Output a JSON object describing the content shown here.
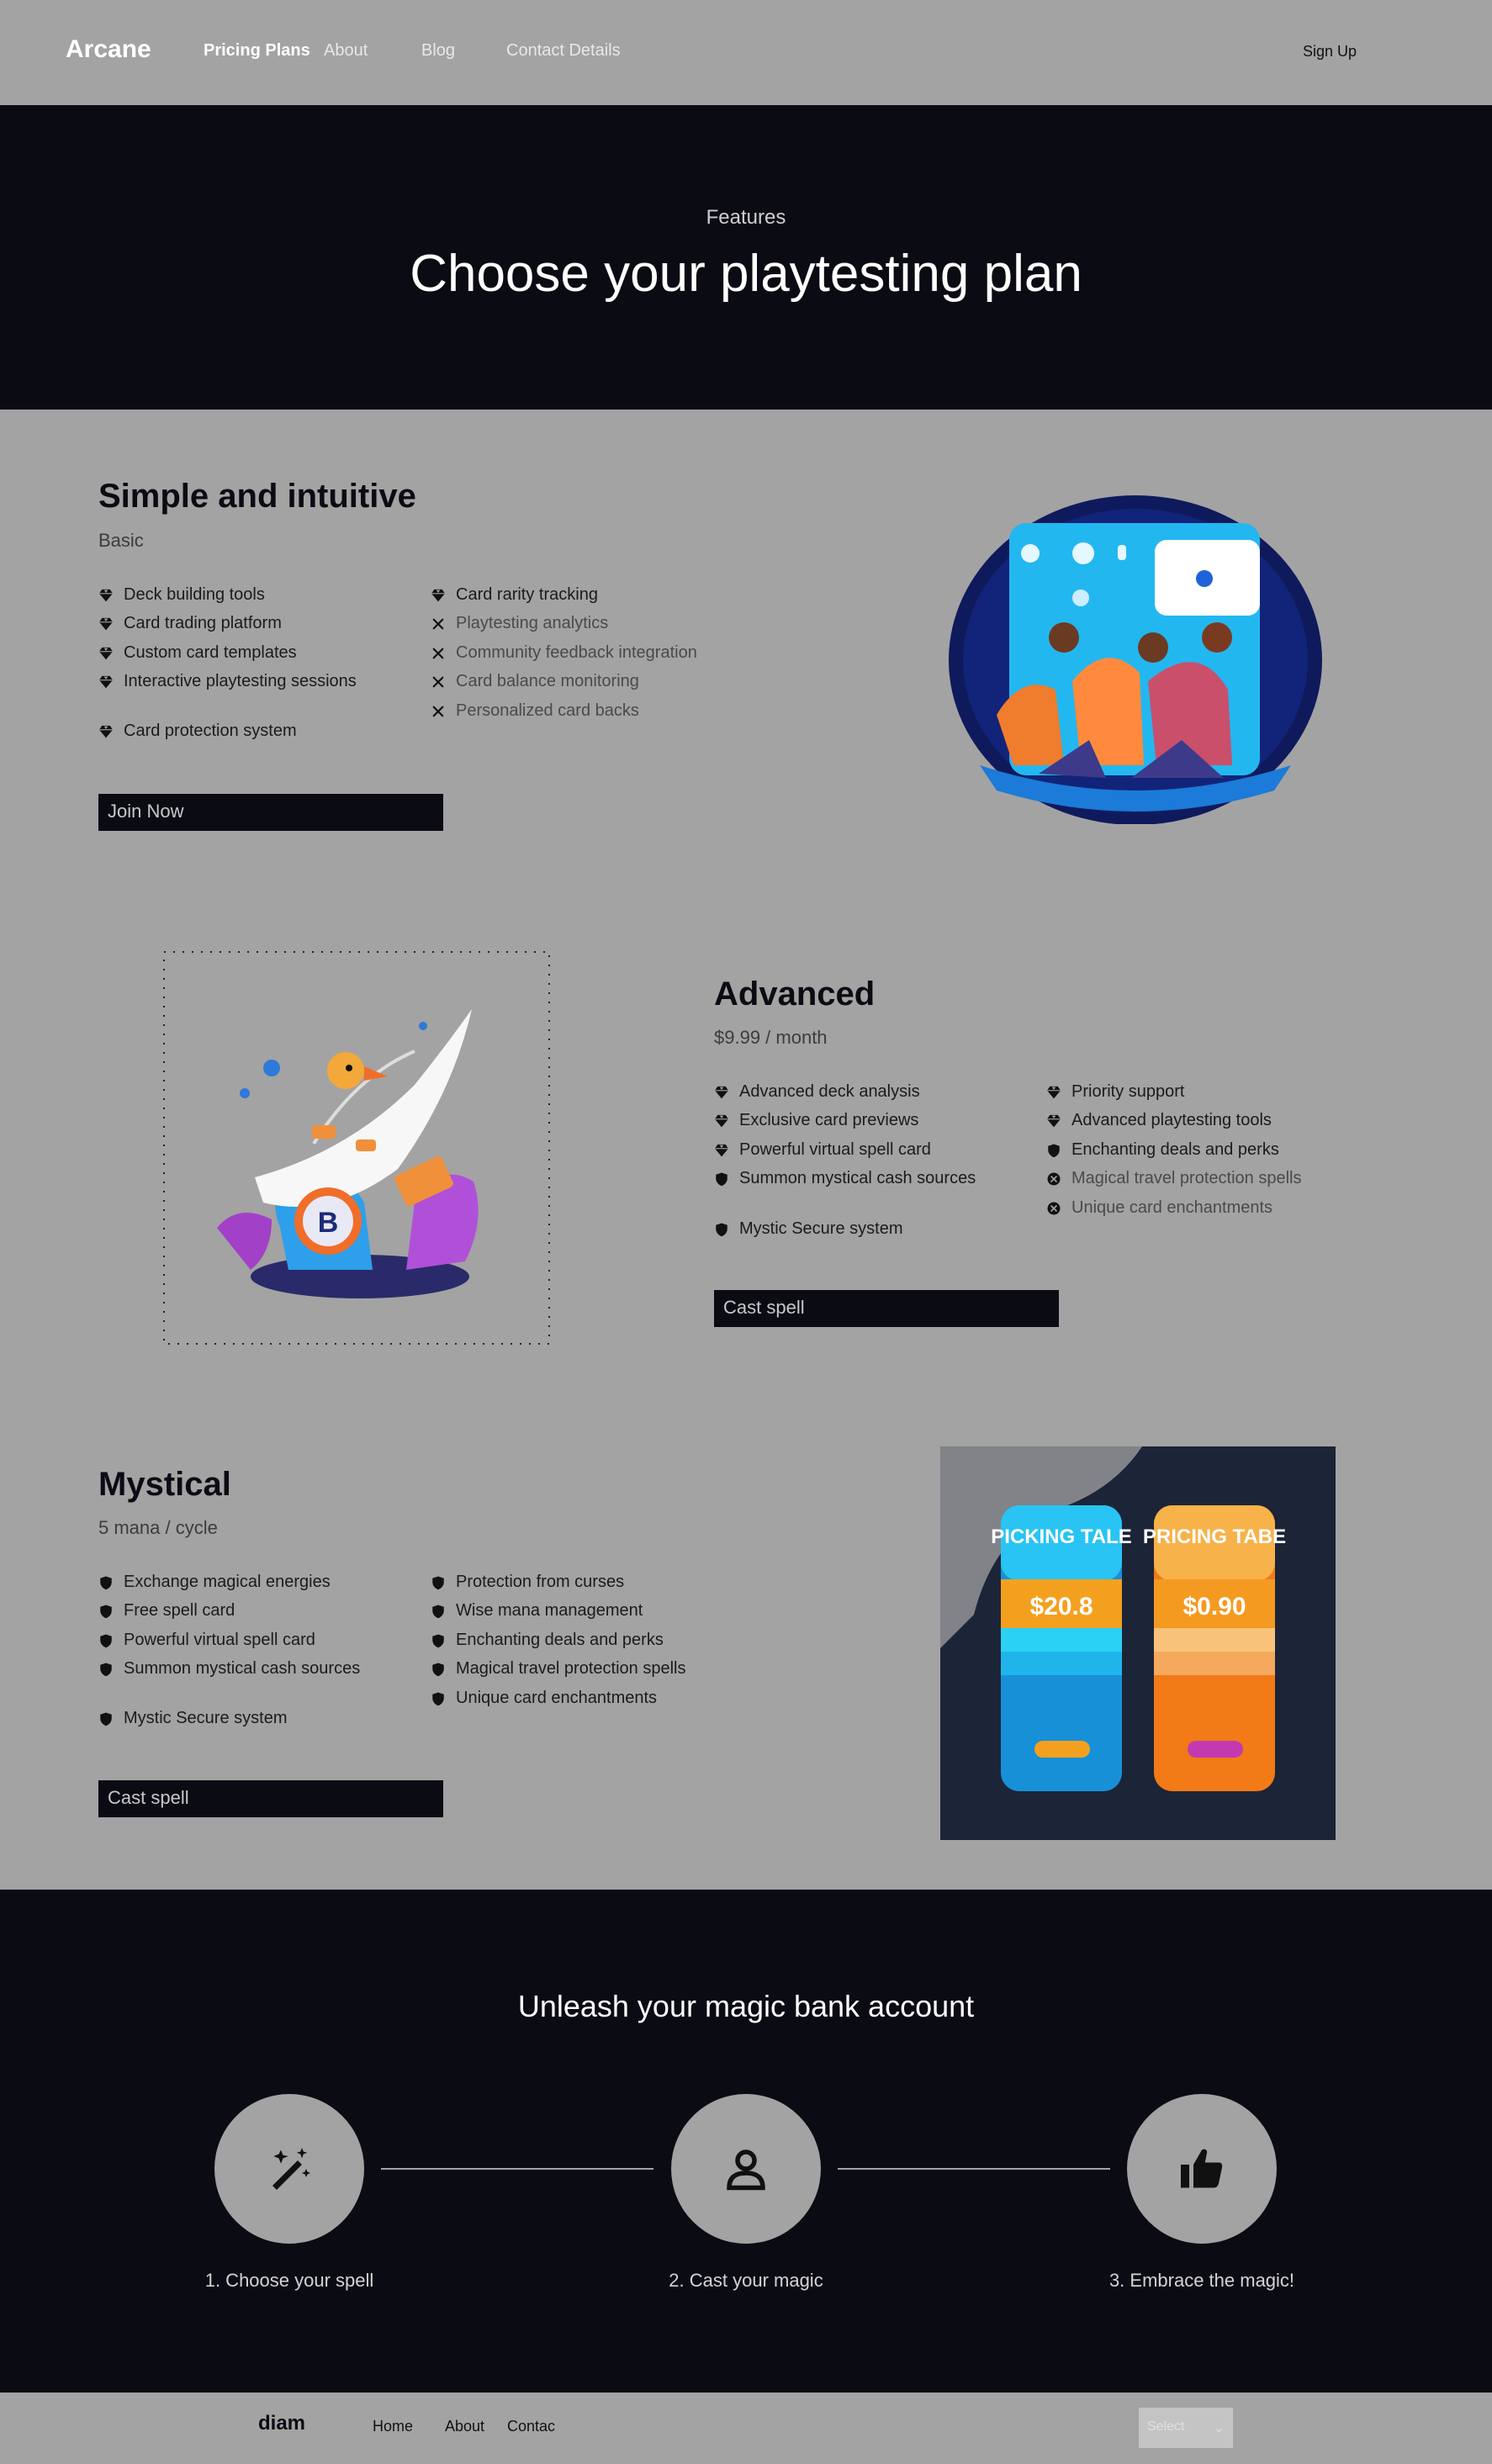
{
  "nav": {
    "brand": "Arcane",
    "links": [
      "Pricing Plans",
      "About",
      "Blog",
      "Contact Details"
    ],
    "signup": "Sign Up"
  },
  "hero": {
    "kicker": "Features",
    "title": "Choose your playtesting plan"
  },
  "plans": [
    {
      "title": "Simple and intuitive",
      "subtitle": "Basic",
      "col1": [
        "Deck building tools",
        "Card trading platform",
        "Custom card templates",
        "Interactive playtesting sessions",
        "Card protection system"
      ],
      "col2": [
        "Card rarity tracking",
        "Playtesting analytics",
        "Community feedback integration",
        "Card balance monitoring",
        "Personalized card backs"
      ],
      "button": "Join Now"
    },
    {
      "title": "Advanced",
      "subtitle": "$9.99 / month",
      "col1": [
        "Advanced deck analysis",
        "Exclusive card previews",
        "Powerful virtual spell card",
        "Summon mystical cash sources",
        "Mystic Secure system"
      ],
      "col2": [
        "Priority support",
        "Advanced playtesting tools",
        "Enchanting deals and perks",
        "Magical travel protection spells",
        "Unique card enchantments"
      ],
      "button": "Cast spell"
    },
    {
      "title": "Mystical",
      "subtitle": "5 mana / cycle",
      "col1": [
        "Exchange magical energies",
        "Free spell card",
        "Powerful virtual spell card",
        "Summon mystical cash sources",
        "Mystic Secure system"
      ],
      "col2": [
        "Protection from curses",
        "Wise mana management",
        "Enchanting deals and perks",
        "Magical travel protection spells",
        "Unique card enchantments"
      ],
      "button": "Cast spell"
    }
  ],
  "pricing_image": {
    "card1_title": "PICKING TALE",
    "card1_price": "$20.8",
    "card2_title": "PRICING TABE",
    "card2_price": "$0.90"
  },
  "steps": {
    "title": "Unleash your magic bank account",
    "items": [
      {
        "label": "1. Choose your spell",
        "icon": "magic-wand-icon"
      },
      {
        "label": "2. Cast your magic",
        "icon": "user-icon"
      },
      {
        "label": "3. Embrace the magic!",
        "icon": "thumbs-up-icon"
      }
    ]
  },
  "footer": {
    "brand": "diam",
    "links": [
      "Home",
      "About",
      "Contac"
    ],
    "select_placeholder": "Select"
  },
  "colors": {
    "dark": "#0b0b14",
    "gray": "#a3a3a3"
  }
}
